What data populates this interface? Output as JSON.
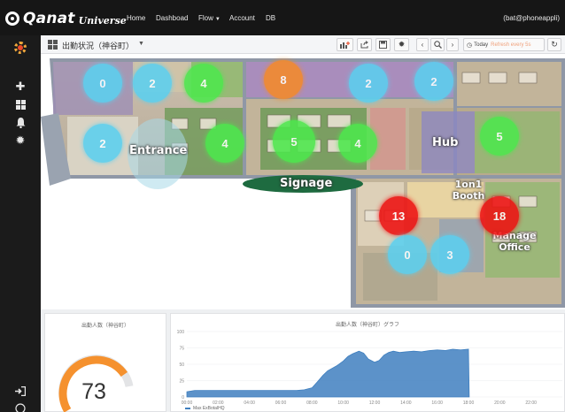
{
  "nav": {
    "brand": "Qanat",
    "brand_sub": "Universe",
    "items": [
      {
        "label": "Home"
      },
      {
        "label": "Dashboad"
      },
      {
        "label": "Flow"
      },
      {
        "label": "Account"
      },
      {
        "label": "DB"
      }
    ],
    "user": "(bat@phoneappli)"
  },
  "dashboard": {
    "title": "出勤状況（神谷町）",
    "time_label": "Today",
    "refresh_label": "Refresh every 5s"
  },
  "floor_map": {
    "zones": [
      {
        "name": "Entrance",
        "label": "Entrance"
      },
      {
        "name": "Signage",
        "label": "Signage"
      },
      {
        "name": "Hub",
        "label": "Hub"
      },
      {
        "name": "1on1 Booth",
        "label": "1on1 Booth"
      },
      {
        "name": "Manage Office",
        "label": "Manage Office"
      }
    ],
    "occupancy": [
      {
        "count": "0",
        "status": "low"
      },
      {
        "count": "2",
        "status": "low"
      },
      {
        "count": "4",
        "status": "medium"
      },
      {
        "count": "8",
        "status": "busy"
      },
      {
        "count": "2",
        "status": "low"
      },
      {
        "count": "2",
        "status": "low"
      },
      {
        "count": "2",
        "status": "low"
      },
      {
        "count": "4",
        "status": "medium"
      },
      {
        "count": "5",
        "status": "medium"
      },
      {
        "count": "4",
        "status": "medium"
      },
      {
        "count": "5",
        "status": "medium"
      },
      {
        "count": "13",
        "status": "full"
      },
      {
        "count": "18",
        "status": "full"
      },
      {
        "count": "0",
        "status": "low"
      },
      {
        "count": "3",
        "status": "low"
      }
    ],
    "status_colors": {
      "low": "#5bd0f0",
      "medium": "#4de84d",
      "busy": "#f58a2a",
      "full": "#ee1111"
    }
  },
  "gauge": {
    "title": "出勤人数（神谷町）",
    "value": "73",
    "color": "#f5912e"
  },
  "graph": {
    "title": "出勤人数（神谷町）グラフ",
    "legend": "Max ExBotalHQ",
    "color": "#3f7fbf"
  },
  "chart_data": {
    "type": "area",
    "title": "出勤人数（神谷町）グラフ",
    "xlabel": "",
    "ylabel": "",
    "ylim": [
      0,
      100
    ],
    "y_ticks": [
      0,
      25,
      50,
      75,
      100
    ],
    "x_ticks": [
      "00:00",
      "02:00",
      "04:00",
      "06:00",
      "08:00",
      "10:00",
      "12:00",
      "14:00",
      "16:00",
      "18:00",
      "20:00",
      "22:00"
    ],
    "series": [
      {
        "name": "Max ExBotalHQ",
        "x_hours": [
          0,
          0.5,
          1,
          2,
          3,
          4,
          5,
          6,
          7,
          7.5,
          8,
          8.3,
          8.7,
          9,
          9.3,
          9.6,
          10,
          10.3,
          10.6,
          11,
          11.3,
          11.6,
          12,
          12.3,
          12.6,
          12.9,
          13.2,
          13.6,
          14,
          14.5,
          15,
          15.5,
          16,
          16.5,
          17,
          17.5,
          18,
          18.05
        ],
        "values": [
          8,
          10,
          10,
          10,
          10,
          10,
          10,
          10,
          10,
          11,
          14,
          22,
          33,
          40,
          44,
          48,
          55,
          62,
          66,
          70,
          67,
          58,
          53,
          56,
          64,
          68,
          70,
          68,
          69,
          70,
          69,
          71,
          72,
          71,
          73,
          72,
          73,
          0
        ]
      }
    ]
  }
}
